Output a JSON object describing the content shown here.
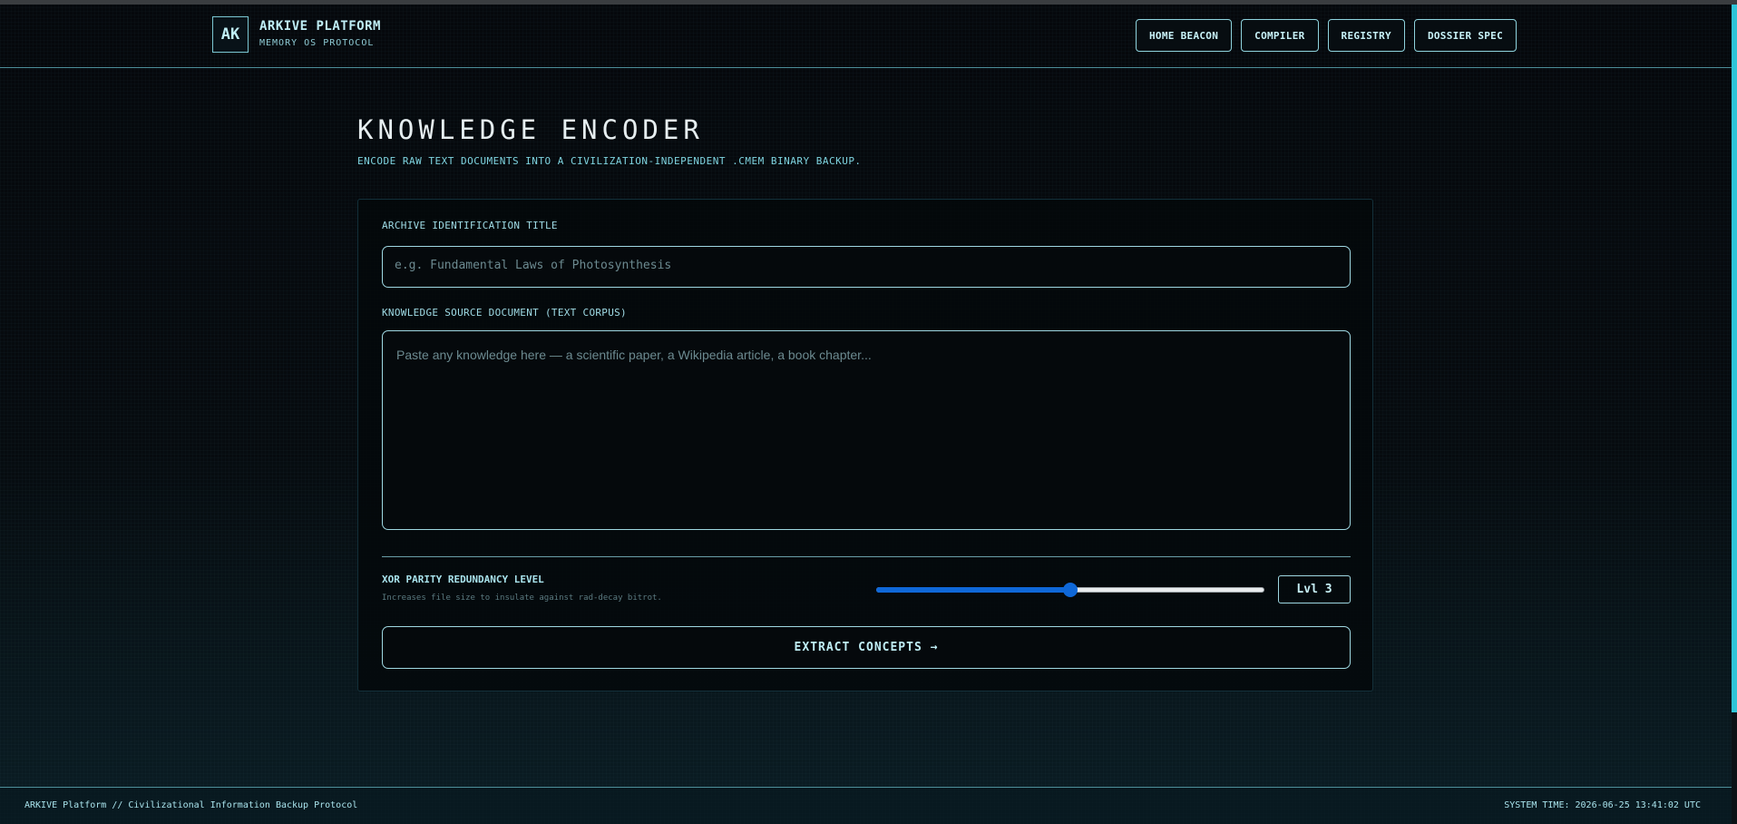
{
  "header": {
    "logo": "AK",
    "title": "ARKIVE PLATFORM",
    "subtitle": "MEMORY OS PROTOCOL",
    "nav": [
      "HOME BEACON",
      "COMPILER",
      "REGISTRY",
      "DOSSIER SPEC"
    ]
  },
  "main": {
    "title": "KNOWLEDGE ENCODER",
    "subtitle": "ENCODE RAW TEXT DOCUMENTS INTO A CIVILIZATION-INDEPENDENT .CMEM BINARY BACKUP.",
    "form": {
      "title_label": "ARCHIVE IDENTIFICATION TITLE",
      "title_placeholder": "e.g. Fundamental Laws of Photosynthesis",
      "title_value": "",
      "source_label": "KNOWLEDGE SOURCE DOCUMENT (TEXT CORPUS)",
      "source_placeholder": "Paste any knowledge here — a scientific paper, a Wikipedia article, a book chapter...",
      "source_value": "",
      "parity_label": "XOR PARITY REDUNDANCY LEVEL",
      "parity_hint": "Increases file size to insulate against rad-decay bitrot.",
      "parity_level": 3,
      "parity_min": 1,
      "parity_max": 5,
      "parity_display": "Lvl 3",
      "submit_label": "EXTRACT CONCEPTS →"
    }
  },
  "footer": {
    "left": "ARKIVE Platform // Civilizational Information Backup Protocol",
    "right": "SYSTEM TIME: 2026-06-25 13:41:02 UTC"
  },
  "colors": {
    "accent": "#7cc8d4",
    "slider": "#0f68d8",
    "background": "#05080b"
  }
}
